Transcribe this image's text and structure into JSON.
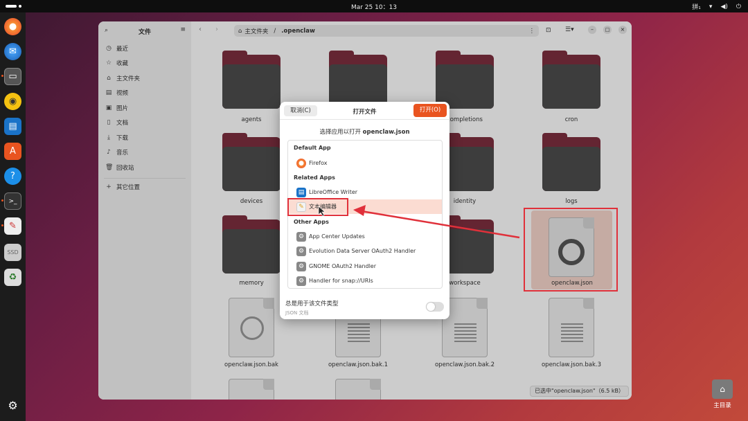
{
  "topbar": {
    "datetime": "Mar 25  10：13",
    "input_method": "拼₁"
  },
  "sidebar": {
    "title": "文件",
    "items": [
      {
        "label": "最近",
        "icon": "clock-icon"
      },
      {
        "label": "收藏",
        "icon": "star-icon"
      },
      {
        "label": "主文件夹",
        "icon": "home-icon"
      },
      {
        "label": "视频",
        "icon": "video-icon"
      },
      {
        "label": "图片",
        "icon": "image-icon"
      },
      {
        "label": "文档",
        "icon": "document-icon"
      },
      {
        "label": "下载",
        "icon": "download-icon"
      },
      {
        "label": "音乐",
        "icon": "music-icon"
      },
      {
        "label": "回收站",
        "icon": "trash-icon"
      }
    ],
    "other_locations": "其它位置"
  },
  "pathbar": {
    "home": "主文件夹",
    "separator": "/",
    "current": ".openclaw"
  },
  "files": [
    {
      "name": "agents"
    },
    {
      "name": "completions"
    },
    {
      "name": "cron"
    },
    {
      "name": "devices"
    },
    {
      "name": "identity"
    },
    {
      "name": "logs"
    },
    {
      "name": "memory"
    },
    {
      "name": "workspace"
    },
    {
      "name": "openclaw.json"
    },
    {
      "name": "openclaw.json.bak"
    },
    {
      "name": "openclaw.json.bak.1"
    },
    {
      "name": "openclaw.json.bak.2"
    },
    {
      "name": "openclaw.json.bak.3"
    }
  ],
  "status": "已选中\"openclaw.json\"（6.5 kB）",
  "dialog": {
    "cancel": "取消(C)",
    "title": "打开文件",
    "open": "打开(O)",
    "subtitle_prefix": "选择应用以打开 ",
    "subtitle_file": "openclaw.json",
    "sections": {
      "default": "Default App",
      "related": "Related Apps",
      "other": "Other Apps"
    },
    "default_apps": [
      {
        "label": "Firefox",
        "icon": "firefox-icon"
      }
    ],
    "related_apps": [
      {
        "label": "LibreOffice Writer",
        "icon": "libreoffice-writer-icon"
      },
      {
        "label": "文本编辑器",
        "icon": "text-editor-icon"
      }
    ],
    "other_apps": [
      {
        "label": "App Center Updates",
        "icon": "gear-icon"
      },
      {
        "label": "Evolution Data Server OAuth2 Handler",
        "icon": "gear-icon"
      },
      {
        "label": "GNOME OAuth2 Handler",
        "icon": "gear-icon"
      },
      {
        "label": "Handler for snap://URIs",
        "icon": "gear-icon"
      }
    ],
    "always_use": "总是用于该文件类型",
    "file_type": "JSON 文档"
  },
  "desktop": {
    "home_label": "主目录"
  }
}
